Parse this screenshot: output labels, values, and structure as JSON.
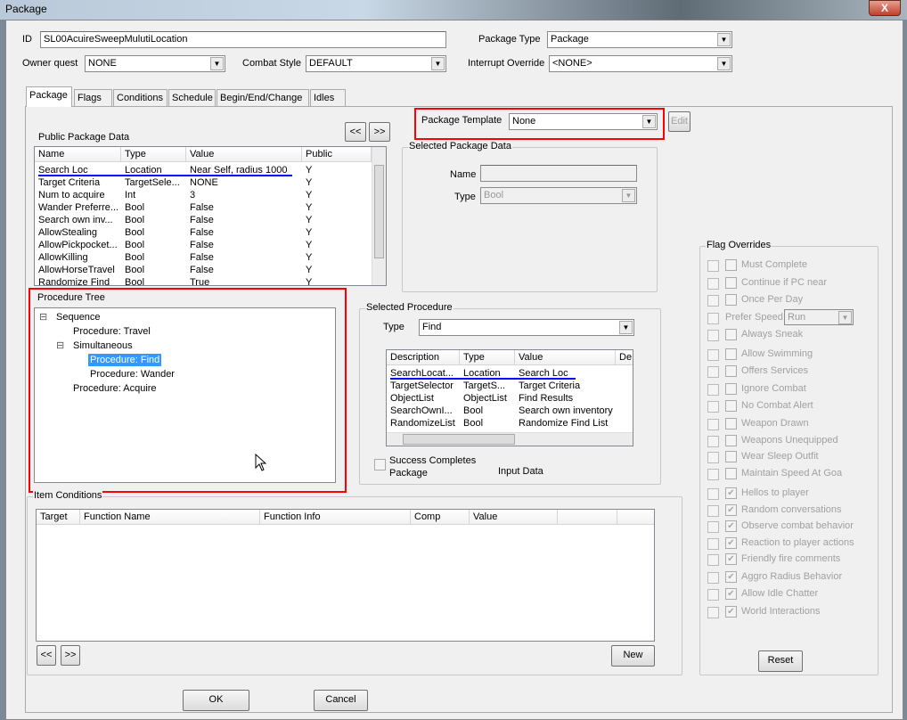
{
  "window": {
    "title": "Package",
    "close": "X"
  },
  "header": {
    "id_label": "ID",
    "id_value": "SL00AcuireSweepMulutiLocation",
    "package_type_label": "Package Type",
    "package_type_value": "Package",
    "owner_quest_label": "Owner quest",
    "owner_quest_value": "NONE",
    "combat_style_label": "Combat Style",
    "combat_style_value": "DEFAULT",
    "interrupt_label": "Interrupt Override",
    "interrupt_value": "<NONE>"
  },
  "tabs": [
    "Package",
    "Flags",
    "Conditions",
    "Schedule",
    "Begin/End/Change",
    "Idles"
  ],
  "template": {
    "label": "Package Template",
    "value": "None",
    "edit": "Edit"
  },
  "nav": {
    "prev": "<<",
    "next": ">>"
  },
  "public_data": {
    "label": "Public Package Data",
    "columns": [
      "Name",
      "Type",
      "Value",
      "Public"
    ],
    "rows": [
      [
        "Search Loc",
        "Location",
        "Near Self, radius 1000",
        "Y"
      ],
      [
        "Target Criteria",
        "TargetSele...",
        "NONE",
        "Y"
      ],
      [
        "Num to acquire",
        "Int",
        "3",
        "Y"
      ],
      [
        "Wander Preferre...",
        "Bool",
        "False",
        "Y"
      ],
      [
        "Search own inv...",
        "Bool",
        "False",
        "Y"
      ],
      [
        "AllowStealing",
        "Bool",
        "False",
        "Y"
      ],
      [
        "AllowPickpocket...",
        "Bool",
        "False",
        "Y"
      ],
      [
        "AllowKilling",
        "Bool",
        "False",
        "Y"
      ],
      [
        "AllowHorseTravel",
        "Bool",
        "False",
        "Y"
      ],
      [
        "Randomize Find",
        "Bool",
        "True",
        "Y"
      ]
    ]
  },
  "selected_package_data": {
    "label": "Selected Package Data",
    "name_label": "Name",
    "name_value": "",
    "type_label": "Type",
    "type_value": "Bool"
  },
  "procedure_tree": {
    "label": "Procedure Tree",
    "nodes": [
      {
        "text": "Sequence",
        "level": 0,
        "expander": "⊟"
      },
      {
        "text": "Procedure: Travel",
        "level": 1
      },
      {
        "text": "Simultaneous",
        "level": 1,
        "expander": "⊟"
      },
      {
        "text": "Procedure: Find",
        "level": 2,
        "selected": true
      },
      {
        "text": "Procedure: Wander",
        "level": 2
      },
      {
        "text": "Procedure: Acquire",
        "level": 1
      }
    ]
  },
  "selected_procedure": {
    "label": "Selected Procedure",
    "type_label": "Type",
    "type_value": "Find",
    "columns": [
      "Description",
      "Type",
      "Value",
      "De"
    ],
    "rows": [
      [
        "SearchLocat...",
        "Location",
        "Search Loc"
      ],
      [
        "TargetSelector",
        "TargetS...",
        "Target Criteria"
      ],
      [
        "ObjectList",
        "ObjectList",
        "Find Results"
      ],
      [
        "SearchOwnI...",
        "Bool",
        "Search own inventory"
      ],
      [
        "RandomizeList",
        "Bool",
        "Randomize Find List"
      ]
    ],
    "success_label": "Success Completes Package",
    "input_data": "Input Data",
    "success_checked": false
  },
  "flag_overrides": {
    "label": "Flag Overrides",
    "reset": "Reset",
    "prefer_speed_label": "Prefer Speed",
    "prefer_speed_value": "Run",
    "flags": [
      {
        "label": "Must Complete",
        "checked": false
      },
      {
        "label": "Continue if PC near",
        "checked": false
      },
      {
        "label": "Once Per Day",
        "checked": false
      },
      {
        "label": "PREFER_SPEED"
      },
      {
        "label": "Always Sneak",
        "checked": false
      },
      {
        "label": "Allow Swimming",
        "checked": false
      },
      {
        "label": "Offers Services",
        "checked": false
      },
      {
        "label": "Ignore Combat",
        "checked": false
      },
      {
        "label": "No Combat Alert",
        "checked": false
      },
      {
        "label": "Weapon Drawn",
        "checked": false
      },
      {
        "label": "Weapons Unequipped",
        "checked": false
      },
      {
        "label": "Wear Sleep Outfit",
        "checked": false
      },
      {
        "label": "Maintain Speed At Goa",
        "checked": false
      },
      {
        "label": "Hellos to player",
        "checked": true
      },
      {
        "label": "Random conversations",
        "checked": true
      },
      {
        "label": "Observe combat behavior",
        "checked": true
      },
      {
        "label": "Reaction to player actions",
        "checked": true
      },
      {
        "label": "Friendly fire comments",
        "checked": true
      },
      {
        "label": "Aggro Radius Behavior",
        "checked": true
      },
      {
        "label": "Allow Idle Chatter",
        "checked": true
      },
      {
        "label": "World Interactions",
        "checked": true
      }
    ]
  },
  "item_conditions": {
    "label": "Item Conditions",
    "columns": [
      "Target",
      "Function Name",
      "Function Info",
      "Comp",
      "Value",
      "",
      ""
    ],
    "new": "New"
  },
  "footer": {
    "ok": "OK",
    "cancel": "Cancel"
  }
}
